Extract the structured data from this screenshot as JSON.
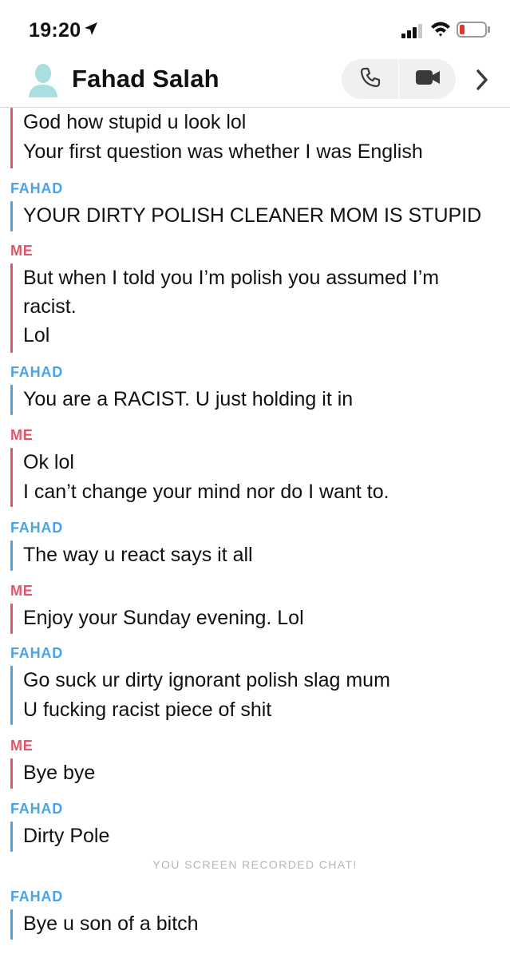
{
  "status_bar": {
    "time": "19:20"
  },
  "header": {
    "contact_name": "Fahad Salah"
  },
  "chat": {
    "first_block": [
      "God how stupid u look lol",
      "Your first question was whether I was English"
    ],
    "groups": [
      {
        "sender": "FAHAD",
        "lines": [
          "YOUR DIRTY POLISH CLEANER MOM IS STUPID"
        ]
      },
      {
        "sender": "ME",
        "lines": [
          "But when I told you I’m polish you assumed I’m",
          "racist.",
          "Lol"
        ]
      },
      {
        "sender": "FAHAD",
        "lines": [
          "You are a RACIST. U just holding it in"
        ]
      },
      {
        "sender": "ME",
        "lines": [
          "Ok lol",
          "I can’t change your mind nor do I want to."
        ]
      },
      {
        "sender": "FAHAD",
        "lines": [
          "The way u react says it all"
        ]
      },
      {
        "sender": "ME",
        "lines": [
          "Enjoy your Sunday evening. Lol"
        ]
      },
      {
        "sender": "FAHAD",
        "lines": [
          "Go suck ur dirty ignorant polish slag mum",
          "U fucking racist piece of shit"
        ]
      },
      {
        "sender": "ME",
        "lines": [
          "Bye bye"
        ]
      },
      {
        "sender": "FAHAD",
        "lines": [
          "Dirty Pole"
        ]
      },
      {
        "sender": "FAHAD",
        "lines": [
          "Bye u son of a bitch"
        ]
      }
    ],
    "notice": "YOU SCREEN RECORDED CHAT!"
  },
  "colors": {
    "fahad": "#4aa3e6",
    "me": "#e0556a",
    "battery_low": "#e0392b"
  },
  "icons": [
    "location-arrow-icon",
    "signal-icon",
    "wifi-icon",
    "battery-icon",
    "avatar-icon",
    "phone-icon",
    "video-icon",
    "chevron-right-icon"
  ]
}
